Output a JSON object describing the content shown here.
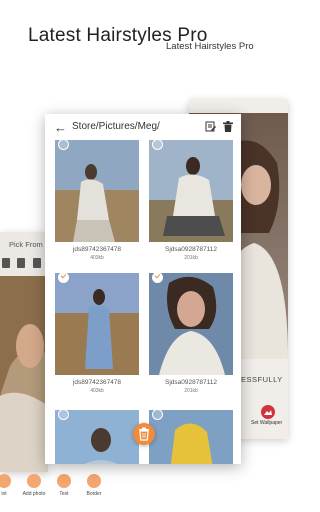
{
  "banner": {
    "title": "Latest Hairstyles Pro",
    "subtitle": "Latest Hairstyles Pro"
  },
  "right_screen": {
    "status_text": "ESSFULLY",
    "set_wallpaper_label": "Set Wallpaper",
    "set_wallpaper_icon": "wallpaper-icon"
  },
  "left_screen": {
    "title": "Pick From",
    "tools": [
      {
        "label": "int",
        "icon": "edit-icon"
      },
      {
        "label": "Add photo",
        "icon": "add-photo-icon"
      },
      {
        "label": "Text",
        "icon": "text-icon"
      },
      {
        "label": "Border",
        "icon": "border-icon"
      }
    ]
  },
  "file_browser": {
    "path": "Store/Pictures/Meg/",
    "files": [
      {
        "name": "jds89742367478",
        "size": "403kb",
        "selected": false
      },
      {
        "name": "Sjdsa0928787112",
        "size": "201kb",
        "selected": false
      },
      {
        "name": "jds89742367478",
        "size": "403kb",
        "selected": true
      },
      {
        "name": "Sjdsa0928787112",
        "size": "201kb",
        "selected": true
      },
      {
        "name": "",
        "size": "",
        "selected": false
      },
      {
        "name": "",
        "size": "",
        "selected": false
      }
    ],
    "accent_color": "#f08a3c"
  }
}
